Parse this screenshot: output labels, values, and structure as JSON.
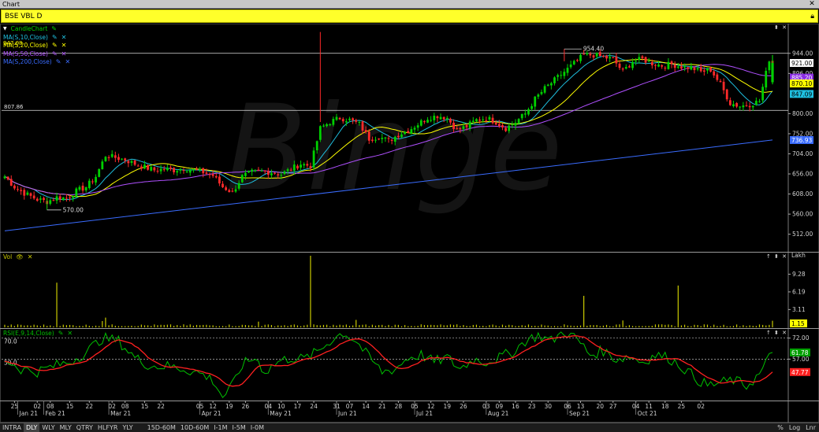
{
  "window": {
    "title": "Chart",
    "close_icon": "close-icon"
  },
  "symbol": {
    "label": "BSE VBL D",
    "lock_icon": "lock-icon"
  },
  "price_panel": {
    "legend": [
      {
        "label": "CandleChart",
        "color": "#00d000",
        "pen": true,
        "close": false,
        "arrow": true
      },
      {
        "label": "MA(S,10,Close)",
        "color": "#1fc0e0",
        "pen": true,
        "close": true
      },
      {
        "label": "MA(S,20,Close)",
        "color": "#ffff00",
        "pen": true,
        "close": true,
        "overlay_label": "947.08"
      },
      {
        "label": "MA(S,50,Close)",
        "color": "#b050ff",
        "pen": true,
        "close": true
      },
      {
        "label": "MA(S,200,Close)",
        "color": "#3a6cff",
        "pen": true,
        "close": true
      }
    ],
    "hlines": [
      {
        "value": 944.0
      },
      {
        "value": 807.86,
        "label": "807.86"
      }
    ],
    "annotations": [
      {
        "label": "954.40",
        "value": 954.4
      },
      {
        "label": "570.00",
        "value": 570.0
      }
    ]
  },
  "vol_panel": {
    "legend": "Vol",
    "legend_color": "#c9c900",
    "unit": "Lakh"
  },
  "rsi_panel": {
    "legend": "RSI(E,9,14,Close)",
    "legend_color": "#00c000",
    "level_high": "70.0",
    "level_low": "50.0"
  },
  "watermark": "Binge",
  "chart_data": [
    {
      "type": "candlestick",
      "title": "BSE VBL D",
      "y_ticks": [
        "944.00",
        "896.00",
        "800.00",
        "752.00",
        "704.00",
        "656.00",
        "608.00",
        "560.00",
        "512.00"
      ],
      "ylim": [
        470,
        1015
      ],
      "last_labels": [
        {
          "text": "921.00",
          "value": 921,
          "bg": "#ffffff",
          "fg": "#000000"
        },
        {
          "text": "885.20",
          "value": 886,
          "bg": "#8a2be2",
          "fg": "#ffffff"
        },
        {
          "text": "870.10",
          "value": 872,
          "bg": "#ffff00",
          "fg": "#000000"
        },
        {
          "text": "847.09",
          "value": 847,
          "bg": "#1fc0e0",
          "fg": "#000000"
        },
        {
          "text": "736.93",
          "value": 736.93,
          "bg": "#3a6cff",
          "fg": "#ffffff"
        }
      ],
      "close_anchors": [
        [
          0,
          650
        ],
        [
          3,
          625
        ],
        [
          6,
          610
        ],
        [
          10,
          595
        ],
        [
          13,
          590
        ],
        [
          16,
          600
        ],
        [
          19,
          598
        ],
        [
          22,
          615
        ],
        [
          25,
          625
        ],
        [
          28,
          650
        ],
        [
          31,
          700
        ],
        [
          34,
          695
        ],
        [
          37,
          690
        ],
        [
          40,
          680
        ],
        [
          43,
          672
        ],
        [
          46,
          665
        ],
        [
          49,
          668
        ],
        [
          52,
          665
        ],
        [
          55,
          670
        ],
        [
          58,
          665
        ],
        [
          61,
          660
        ],
        [
          64,
          652
        ],
        [
          67,
          625
        ],
        [
          70,
          612
        ],
        [
          73,
          650
        ],
        [
          76,
          660
        ],
        [
          79,
          662
        ],
        [
          82,
          660
        ],
        [
          85,
          655
        ],
        [
          88,
          668
        ],
        [
          91,
          680
        ],
        [
          94,
          675
        ],
        [
          97,
          765
        ],
        [
          100,
          780
        ],
        [
          103,
          790
        ],
        [
          106,
          785
        ],
        [
          109,
          775
        ],
        [
          112,
          740
        ],
        [
          115,
          745
        ],
        [
          118,
          735
        ],
        [
          121,
          750
        ],
        [
          124,
          760
        ],
        [
          127,
          775
        ],
        [
          130,
          790
        ],
        [
          133,
          795
        ],
        [
          136,
          790
        ],
        [
          139,
          760
        ],
        [
          142,
          770
        ],
        [
          145,
          785
        ],
        [
          148,
          790
        ],
        [
          151,
          780
        ],
        [
          154,
          765
        ],
        [
          157,
          780
        ],
        [
          160,
          800
        ],
        [
          163,
          835
        ],
        [
          166,
          860
        ],
        [
          169,
          880
        ],
        [
          172,
          900
        ],
        [
          175,
          920
        ],
        [
          178,
          940
        ],
        [
          181,
          940
        ],
        [
          184,
          935
        ],
        [
          187,
          930
        ],
        [
          190,
          900
        ],
        [
          193,
          925
        ],
        [
          196,
          930
        ],
        [
          199,
          920
        ],
        [
          202,
          915
        ],
        [
          205,
          918
        ],
        [
          208,
          912
        ],
        [
          211,
          910
        ],
        [
          214,
          900
        ],
        [
          217,
          905
        ],
        [
          220,
          870
        ],
        [
          223,
          825
        ],
        [
          226,
          818
        ],
        [
          229,
          822
        ],
        [
          232,
          830
        ],
        [
          235,
          930
        ],
        [
          236,
          921
        ]
      ],
      "ma_periods": [
        10,
        20,
        50
      ],
      "ma200": [
        [
          0,
          520
        ],
        [
          236,
          737
        ]
      ],
      "x_ticks": [
        {
          "label": "25",
          "i": 3
        },
        {
          "label": "02",
          "i": 10
        },
        {
          "label": "08",
          "i": 14
        },
        {
          "label": "15",
          "i": 20
        },
        {
          "label": "22",
          "i": 26
        },
        {
          "label": "02",
          "i": 33
        },
        {
          "label": "08",
          "i": 37
        },
        {
          "label": "15",
          "i": 43
        },
        {
          "label": "22",
          "i": 48
        },
        {
          "label": "05",
          "i": 60
        },
        {
          "label": "12",
          "i": 64
        },
        {
          "label": "19",
          "i": 69
        },
        {
          "label": "26",
          "i": 74
        },
        {
          "label": "04",
          "i": 81
        },
        {
          "label": "10",
          "i": 85
        },
        {
          "label": "17",
          "i": 90
        },
        {
          "label": "24",
          "i": 95
        },
        {
          "label": "31",
          "i": 102
        },
        {
          "label": "07",
          "i": 106
        },
        {
          "label": "14",
          "i": 111
        },
        {
          "label": "21",
          "i": 116
        },
        {
          "label": "28",
          "i": 121
        },
        {
          "label": "05",
          "i": 126
        },
        {
          "label": "12",
          "i": 131
        },
        {
          "label": "19",
          "i": 136
        },
        {
          "label": "26",
          "i": 141
        },
        {
          "label": "03",
          "i": 148
        },
        {
          "label": "09",
          "i": 152
        },
        {
          "label": "16",
          "i": 157
        },
        {
          "label": "23",
          "i": 162
        },
        {
          "label": "30",
          "i": 167
        },
        {
          "label": "06",
          "i": 173
        },
        {
          "label": "13",
          "i": 177
        },
        {
          "label": "20",
          "i": 183
        },
        {
          "label": "27",
          "i": 187
        },
        {
          "label": "04",
          "i": 194
        },
        {
          "label": "11",
          "i": 198
        },
        {
          "label": "18",
          "i": 203
        },
        {
          "label": "25",
          "i": 208
        },
        {
          "label": "02",
          "i": 214
        }
      ],
      "month_labels": [
        {
          "label": "Jan 21",
          "i": 4
        },
        {
          "label": "Feb 21",
          "i": 12
        },
        {
          "label": "Mar 21",
          "i": 32
        },
        {
          "label": "Apr 21",
          "i": 60
        },
        {
          "label": "May 21",
          "i": 81
        },
        {
          "label": "Jun 21",
          "i": 102
        },
        {
          "label": "Jul 21",
          "i": 126
        },
        {
          "label": "Aug 21",
          "i": 148
        },
        {
          "label": "Sep 21",
          "i": 173
        },
        {
          "label": "Oct 21",
          "i": 194
        }
      ]
    },
    {
      "type": "bar",
      "title": "Vol",
      "y_ticks": [
        "9.28",
        "6.19",
        "3.11"
      ],
      "ylim": [
        0,
        12.5
      ],
      "last_label": "1.15",
      "spikes": [
        [
          16,
          7.8
        ],
        [
          30,
          1.1
        ],
        [
          31,
          1.7
        ],
        [
          78,
          1.0
        ],
        [
          94,
          12.5
        ],
        [
          108,
          1.3
        ],
        [
          178,
          5.5
        ],
        [
          190,
          1.2
        ],
        [
          207,
          7.3
        ],
        [
          236,
          1.15
        ]
      ],
      "base": 0.35
    },
    {
      "type": "line",
      "title": "RSI(E,9,14,Close)",
      "y_ticks": [
        "72.00",
        "57.00"
      ],
      "level_labels": [
        "70.0",
        "50.0"
      ],
      "hlines": [
        72,
        57
      ],
      "ylim": [
        28,
        78
      ],
      "last_labels": [
        {
          "text": "61.78",
          "bg": "#00a000",
          "fg": "#ffffff"
        },
        {
          "text": "47.77",
          "bg": "#ff2020",
          "fg": "#ffffff"
        }
      ],
      "rsi_anchors": [
        [
          0,
          57
        ],
        [
          5,
          50
        ],
        [
          10,
          48
        ],
        [
          15,
          52
        ],
        [
          20,
          55
        ],
        [
          25,
          62
        ],
        [
          30,
          72
        ],
        [
          35,
          70
        ],
        [
          40,
          58
        ],
        [
          45,
          52
        ],
        [
          50,
          52
        ],
        [
          55,
          50
        ],
        [
          60,
          47
        ],
        [
          64,
          42
        ],
        [
          67,
          30
        ],
        [
          70,
          38
        ],
        [
          73,
          53
        ],
        [
          77,
          58
        ],
        [
          80,
          48
        ],
        [
          84,
          55
        ],
        [
          88,
          58
        ],
        [
          92,
          57
        ],
        [
          96,
          62
        ],
        [
          100,
          70
        ],
        [
          104,
          76
        ],
        [
          108,
          70
        ],
        [
          112,
          58
        ],
        [
          116,
          48
        ],
        [
          120,
          50
        ],
        [
          124,
          58
        ],
        [
          128,
          60
        ],
        [
          132,
          55
        ],
        [
          136,
          58
        ],
        [
          140,
          50
        ],
        [
          144,
          57
        ],
        [
          148,
          55
        ],
        [
          152,
          58
        ],
        [
          156,
          62
        ],
        [
          160,
          70
        ],
        [
          164,
          74
        ],
        [
          168,
          70
        ],
        [
          172,
          77
        ],
        [
          176,
          71
        ],
        [
          180,
          60
        ],
        [
          184,
          63
        ],
        [
          188,
          57
        ],
        [
          192,
          59
        ],
        [
          196,
          55
        ],
        [
          200,
          60
        ],
        [
          204,
          58
        ],
        [
          208,
          52
        ],
        [
          212,
          44
        ],
        [
          216,
          38
        ],
        [
          220,
          40
        ],
        [
          224,
          42
        ],
        [
          228,
          38
        ],
        [
          232,
          46
        ],
        [
          236,
          62
        ]
      ]
    }
  ]
}
